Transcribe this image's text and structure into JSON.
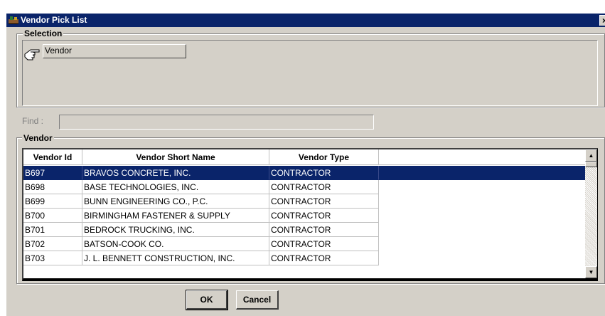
{
  "window": {
    "title": "Vendor Pick List",
    "close_glyph": "×"
  },
  "selection": {
    "group_label": "Selection",
    "item_label": "Vendor",
    "icon": "pointing-hand-icon"
  },
  "find": {
    "label": "Find :",
    "value": ""
  },
  "vendor_grid": {
    "group_label": "Vendor",
    "columns": [
      "Vendor Id",
      "Vendor Short Name",
      "Vendor Type"
    ],
    "rows": [
      {
        "id": "B697",
        "name": "BRAVOS CONCRETE, INC.",
        "type": "CONTRACTOR",
        "selected": true
      },
      {
        "id": "B698",
        "name": "BASE TECHNOLOGIES, INC.",
        "type": "CONTRACTOR"
      },
      {
        "id": "B699",
        "name": "BUNN ENGINEERING CO., P.C.",
        "type": "CONTRACTOR"
      },
      {
        "id": "B700",
        "name": "BIRMINGHAM FASTENER & SUPPLY",
        "type": "CONTRACTOR"
      },
      {
        "id": "B701",
        "name": "BEDROCK TRUCKING, INC.",
        "type": "CONTRACTOR"
      },
      {
        "id": "B702",
        "name": "BATSON-COOK CO.",
        "type": "CONTRACTOR"
      },
      {
        "id": "B703",
        "name": "J. L. BENNETT CONSTRUCTION, INC.",
        "type": "CONTRACTOR"
      }
    ]
  },
  "buttons": {
    "ok": "OK",
    "cancel": "Cancel"
  },
  "colors": {
    "titlebar": "#0a246a",
    "face": "#d4d0c8",
    "selection": "#0a246a"
  }
}
